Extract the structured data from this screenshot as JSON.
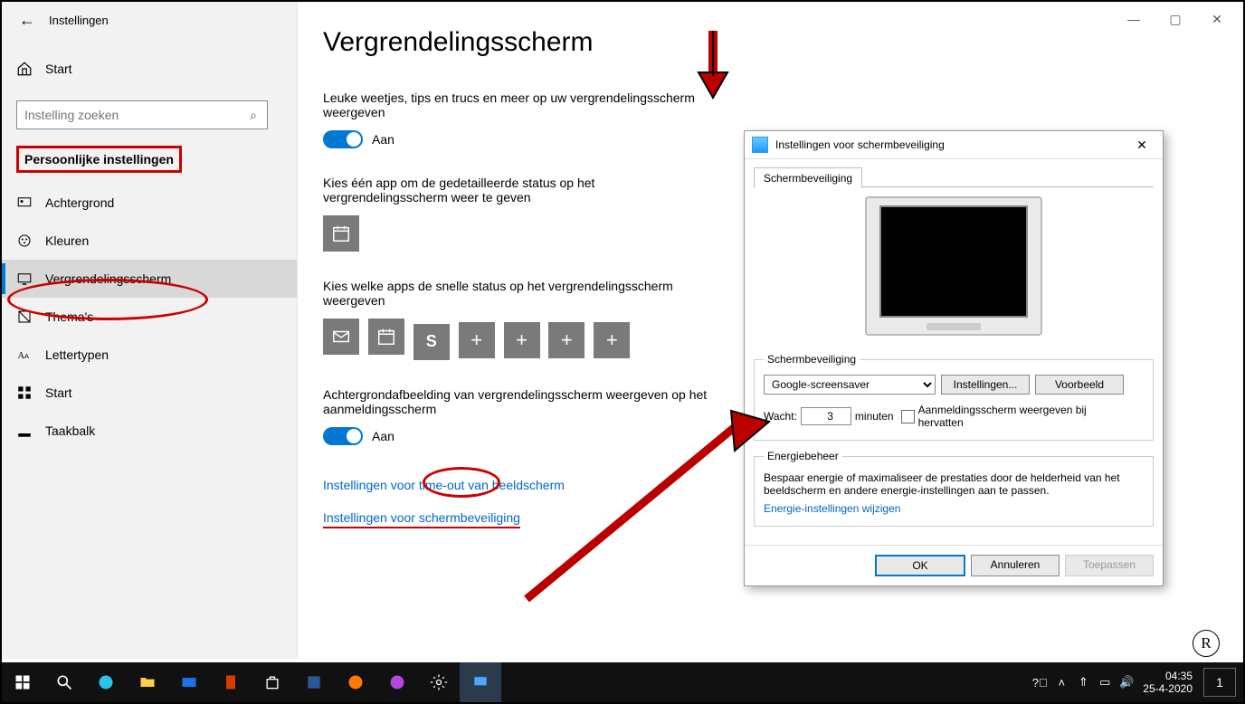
{
  "window": {
    "title": "Instellingen",
    "home": "Start",
    "search_placeholder": "Instelling zoeken",
    "category": "Persoonlijke instellingen"
  },
  "nav": [
    {
      "label": "Achtergrond"
    },
    {
      "label": "Kleuren"
    },
    {
      "label": "Vergrendelingsscherm",
      "selected": true
    },
    {
      "label": "Thema's"
    },
    {
      "label": "Lettertypen"
    },
    {
      "label": "Start"
    },
    {
      "label": "Taakbalk"
    }
  ],
  "page": {
    "title": "Vergrendelingsscherm",
    "tips_text": "Leuke weetjes, tips en trucs en meer op uw vergrendelingsscherm weergeven",
    "toggle_on": "Aan",
    "detailed_text": "Kies één app om de gedetailleerde status op het vergrendelingsscherm weer te geven",
    "quick_text": "Kies welke apps de snelle status op het vergrendelingsscherm weergeven",
    "background_text": "Achtergrondafbeelding van vergrendelingsscherm weergeven op het aanmeldingsscherm",
    "link_timeout": "Instellingen voor time-out van beeldscherm",
    "link_screensaver": "Instellingen voor schermbeveiliging"
  },
  "dialog": {
    "title": "Instellingen voor schermbeveiliging",
    "tab": "Schermbeveiliging",
    "group1": "Schermbeveiliging",
    "select_value": "Google-screensaver",
    "btn_settings": "Instellingen...",
    "btn_preview": "Voorbeeld",
    "wait_label": "Wacht:",
    "wait_value": "3",
    "wait_unit": "minuten",
    "checkbox_label": "Aanmeldingsscherm weergeven bij hervatten",
    "group2": "Energiebeheer",
    "energy_text": "Bespaar energie of maximaliseer de prestaties door de helderheid van het beeldscherm en andere energie-instellingen aan te passen.",
    "energy_link": "Energie-instellingen wijzigen",
    "ok": "OK",
    "cancel": "Annuleren",
    "apply": "Toepassen"
  },
  "taskbar": {
    "time": "04:35",
    "date": "25-4-2020",
    "notif_count": "1"
  }
}
